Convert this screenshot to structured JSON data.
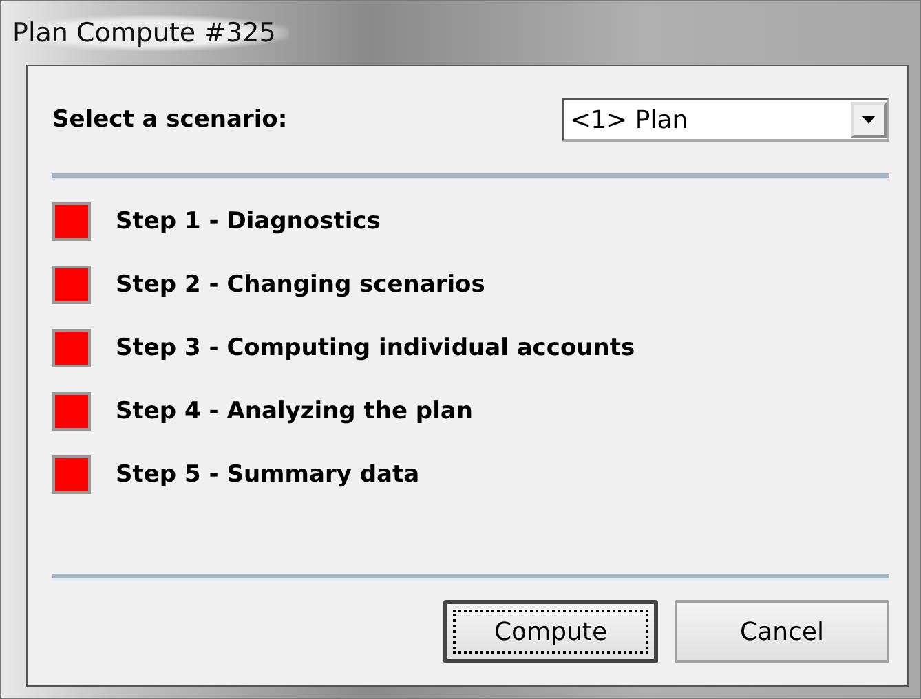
{
  "window": {
    "title": "Plan Compute #325"
  },
  "scenario": {
    "label": "Select a scenario:",
    "value": "<1> Plan"
  },
  "steps": [
    {
      "label": "Step 1 - Diagnostics",
      "color": "#ff0000"
    },
    {
      "label": "Step 2 - Changing scenarios",
      "color": "#ff0000"
    },
    {
      "label": "Step 3 - Computing individual accounts",
      "color": "#ff0000"
    },
    {
      "label": "Step 4 - Analyzing the plan",
      "color": "#ff0000"
    },
    {
      "label": "Step 5 - Summary data",
      "color": "#ff0000"
    }
  ],
  "buttons": [
    {
      "label": "Compute",
      "default": true
    },
    {
      "label": "Cancel",
      "default": false
    }
  ]
}
